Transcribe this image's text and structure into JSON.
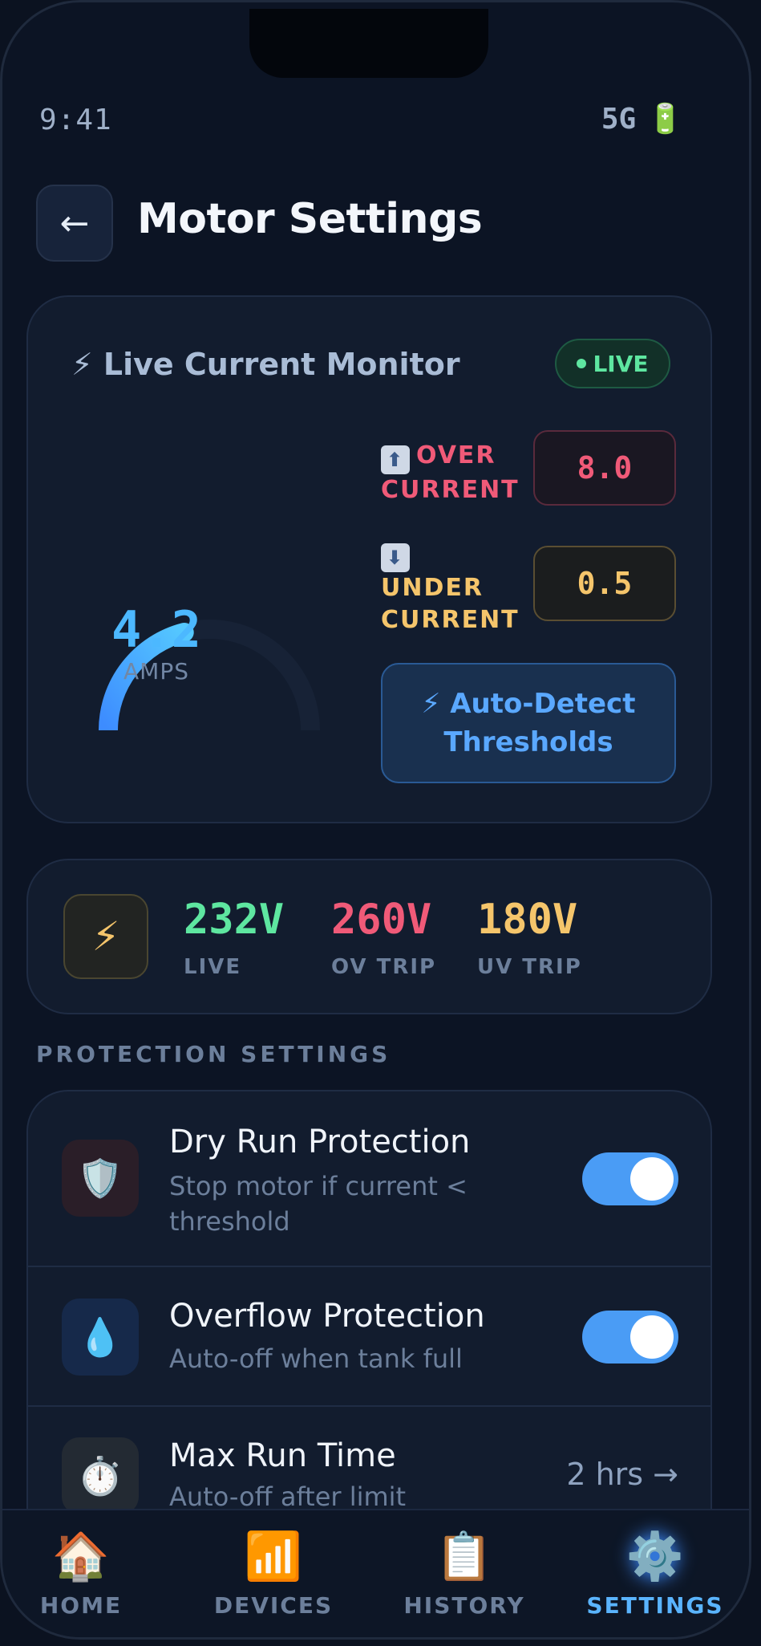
{
  "status": {
    "time": "9:41",
    "network": "5G",
    "battery_icon": "🔋"
  },
  "header": {
    "back_icon": "←",
    "title": "Motor Settings"
  },
  "live_monitor": {
    "title": "⚡ Live Current Monitor",
    "live_badge": "LIVE",
    "current_value": "4.2",
    "current_unit": "AMPS",
    "gauge_fraction": 0.42,
    "over_current": {
      "label_line1": "OVER",
      "label_line2": "CURRENT",
      "value": "8.0"
    },
    "under_current": {
      "label_line1": "UNDER",
      "label_line2": "CURRENT",
      "value": "0.5"
    },
    "auto_detect_line1": "⚡ Auto-Detect",
    "auto_detect_line2": "Thresholds"
  },
  "voltage": {
    "icon": "⚡",
    "stats": [
      {
        "value": "232V",
        "label": "LIVE",
        "color": "#5ee6a0"
      },
      {
        "value": "260V",
        "label": "OV TRIP",
        "color": "#f05a78"
      },
      {
        "value": "180V",
        "label": "UV TRIP",
        "color": "#f5c56b"
      }
    ]
  },
  "protection": {
    "section_label": "PROTECTION SETTINGS",
    "rows": [
      {
        "icon": "🛡️",
        "title": "Dry Run Protection",
        "subtitle": "Stop motor if current < threshold",
        "enabled": true
      },
      {
        "icon": "💧",
        "title": "Overflow Protection",
        "subtitle": "Auto-off when tank full",
        "enabled": true
      },
      {
        "icon": "⏱️",
        "title": "Max Run Time",
        "subtitle": "Auto-off after limit",
        "value": "2 hrs →"
      }
    ]
  },
  "nav": {
    "items": [
      {
        "icon": "🏠",
        "label": "HOME"
      },
      {
        "icon": "📶",
        "label": "DEVICES"
      },
      {
        "icon": "📋",
        "label": "HISTORY"
      },
      {
        "icon": "⚙️",
        "label": "SETTINGS",
        "active": true
      }
    ]
  }
}
